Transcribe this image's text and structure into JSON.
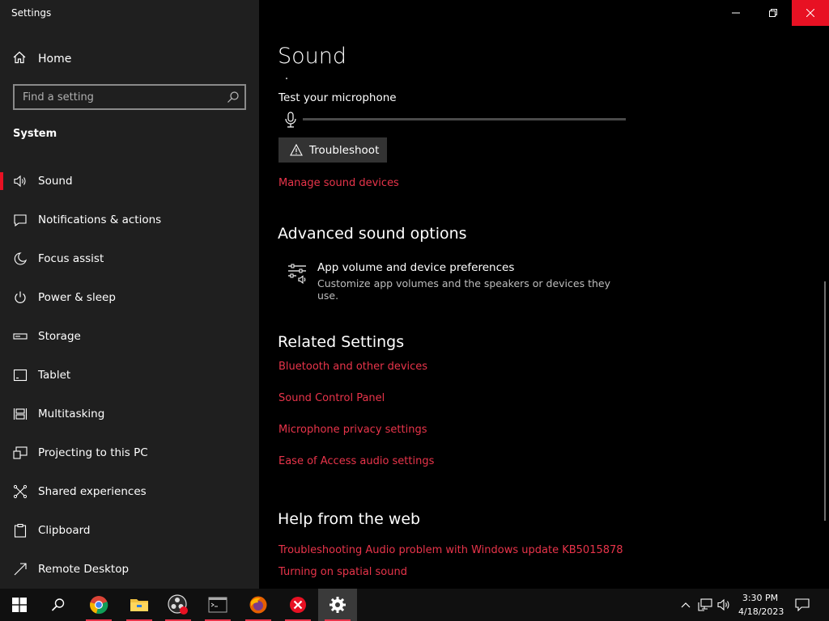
{
  "window": {
    "title": "Settings"
  },
  "sidebar": {
    "home_label": "Home",
    "search_placeholder": "Find a setting",
    "section_title": "System",
    "items": [
      {
        "label": "Sound",
        "icon": "speaker-icon",
        "active": true
      },
      {
        "label": "Notifications & actions",
        "icon": "notification-icon"
      },
      {
        "label": "Focus assist",
        "icon": "moon-icon"
      },
      {
        "label": "Power & sleep",
        "icon": "power-icon"
      },
      {
        "label": "Storage",
        "icon": "storage-icon"
      },
      {
        "label": "Tablet",
        "icon": "tablet-icon"
      },
      {
        "label": "Multitasking",
        "icon": "multitasking-icon"
      },
      {
        "label": "Projecting to this PC",
        "icon": "projector-icon"
      },
      {
        "label": "Shared experiences",
        "icon": "shared-icon"
      },
      {
        "label": "Clipboard",
        "icon": "clipboard-icon"
      },
      {
        "label": "Remote Desktop",
        "icon": "remote-desktop-icon"
      }
    ]
  },
  "main": {
    "title": "Sound",
    "mic_test_label": "Test your microphone",
    "mic_level": 0,
    "troubleshoot_label": "Troubleshoot",
    "manage_devices_link": "Manage sound devices",
    "advanced_heading": "Advanced sound options",
    "app_volume_title": "App volume and device preferences",
    "app_volume_desc": "Customize app volumes and the speakers or devices they use.",
    "related_heading": "Related Settings",
    "related_links": [
      "Bluetooth and other devices",
      "Sound Control Panel",
      "Microphone privacy settings",
      "Ease of Access audio settings"
    ],
    "help_heading": "Help from the web",
    "help_links": [
      "Troubleshooting Audio problem with Windows update KB5015878",
      "Turning on spatial sound"
    ]
  },
  "taskbar": {
    "time": "3:30 PM",
    "date": "4/18/2023",
    "apps": [
      "start-icon",
      "search-icon",
      "chrome-icon",
      "file-explorer-icon",
      "obs-icon",
      "terminal-icon",
      "firefox-icon",
      "x-app-icon",
      "settings-icon"
    ]
  },
  "colors": {
    "accent": "#e81123",
    "link": "#e8344a",
    "sidebar_bg": "#1f1f1f",
    "main_bg": "#000000"
  }
}
